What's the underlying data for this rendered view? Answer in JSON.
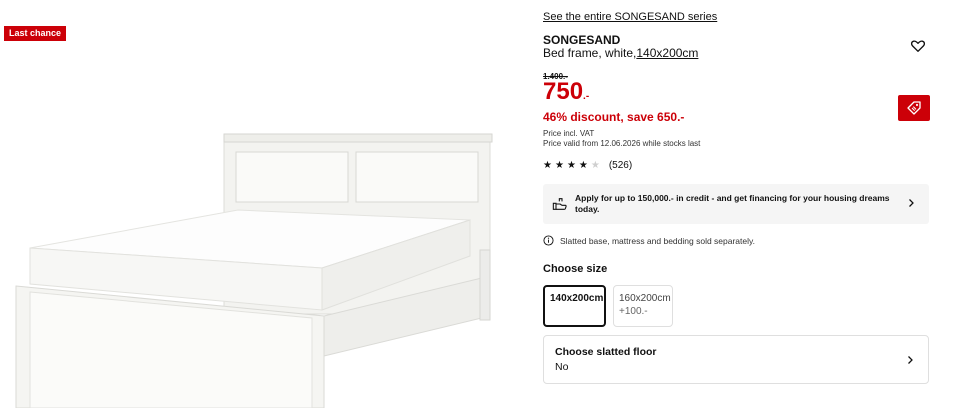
{
  "gallery": {
    "badge": "Last chance"
  },
  "product": {
    "series_link": "See the entire SONGESAND series",
    "name": "SONGESAND",
    "description": "Bed frame, white,",
    "size_link": "140x200cm",
    "old_price": "1.400.-",
    "price": "750",
    "price_suffix": ".-",
    "discount": "46% discount, save 650.-",
    "price_note_1": "Price incl. VAT",
    "price_note_2": "Price valid from 12.06.2026 while stocks last"
  },
  "rating": {
    "stars_filled": 4,
    "stars_total": 5,
    "count": "(526)"
  },
  "finance": {
    "text": "Apply for up to 150,000.- in credit - and get financing for your housing dreams today."
  },
  "notice": {
    "text": "Slatted base, mattress and bedding sold separately."
  },
  "size": {
    "heading": "Choose size",
    "options": [
      {
        "label": "140x200cm",
        "extra": ""
      },
      {
        "label": "160x200cm",
        "extra": "+100.-"
      }
    ]
  },
  "slatted_floor": {
    "title": "Choose slatted floor",
    "value": "No"
  },
  "colors": {
    "accent_red": "#cc0008",
    "panel_grey": "#f5f5f5"
  },
  "icons": {
    "favorite": "heart-icon",
    "price_tag": "tag-icon",
    "finance": "hand-money-icon",
    "info": "info-icon",
    "chevron": "chevron-right-icon"
  }
}
